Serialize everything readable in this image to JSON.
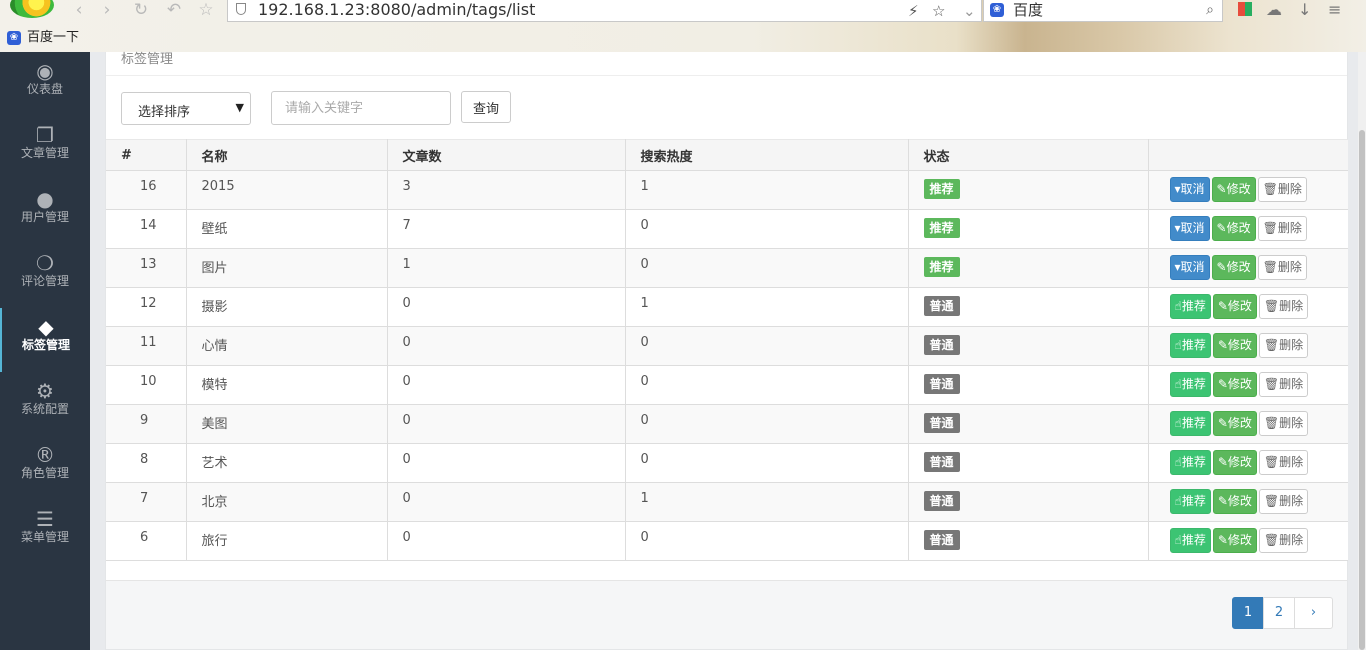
{
  "browser": {
    "url": "192.168.1.23:8080/admin/tags/list",
    "search_engine": "百度",
    "bookmark": "百度一下"
  },
  "sidebar": {
    "items": [
      {
        "label": "仪表盘",
        "icon": "dashboard-icon",
        "glyph": "◉"
      },
      {
        "label": "文章管理",
        "icon": "documents-icon",
        "glyph": "❐"
      },
      {
        "label": "用户管理",
        "icon": "user-icon",
        "glyph": "●"
      },
      {
        "label": "评论管理",
        "icon": "comments-icon",
        "glyph": "❍"
      },
      {
        "label": "标签管理",
        "icon": "tags-icon",
        "glyph": "◆",
        "active": true
      },
      {
        "label": "系统配置",
        "icon": "gear-icon",
        "glyph": "⚙"
      },
      {
        "label": "角色管理",
        "icon": "registered-icon",
        "glyph": "®"
      },
      {
        "label": "菜单管理",
        "icon": "bars-icon",
        "glyph": "☰"
      }
    ]
  },
  "panel": {
    "heading": "标签管理",
    "sort_select": "选择排序",
    "keyword_placeholder": "请输入关键字",
    "query_button": "查询"
  },
  "table": {
    "headers": [
      "#",
      "名称",
      "文章数",
      "搜索热度",
      "状态",
      ""
    ],
    "rows": [
      {
        "id": "16",
        "name": "2015",
        "articles": "3",
        "heat": "1",
        "status": "推荐",
        "recommended": true
      },
      {
        "id": "14",
        "name": "壁纸",
        "articles": "7",
        "heat": "0",
        "status": "推荐",
        "recommended": true
      },
      {
        "id": "13",
        "name": "图片",
        "articles": "1",
        "heat": "0",
        "status": "推荐",
        "recommended": true
      },
      {
        "id": "12",
        "name": "摄影",
        "articles": "0",
        "heat": "1",
        "status": "普通",
        "recommended": false
      },
      {
        "id": "11",
        "name": "心情",
        "articles": "0",
        "heat": "0",
        "status": "普通",
        "recommended": false
      },
      {
        "id": "10",
        "name": "模特",
        "articles": "0",
        "heat": "0",
        "status": "普通",
        "recommended": false
      },
      {
        "id": "9",
        "name": "美图",
        "articles": "0",
        "heat": "0",
        "status": "普通",
        "recommended": false
      },
      {
        "id": "8",
        "name": "艺术",
        "articles": "0",
        "heat": "0",
        "status": "普通",
        "recommended": false
      },
      {
        "id": "7",
        "name": "北京",
        "articles": "0",
        "heat": "1",
        "status": "普通",
        "recommended": false
      },
      {
        "id": "6",
        "name": "旅行",
        "articles": "0",
        "heat": "0",
        "status": "普通",
        "recommended": false
      }
    ],
    "actions": {
      "cancel": "取消",
      "recommend": "推荐",
      "edit": "修改",
      "delete": "删除"
    }
  },
  "pagination": {
    "pages": [
      "1",
      "2"
    ],
    "current": "1",
    "next": "›"
  },
  "colors": {
    "sidebar_bg": "#2a3542",
    "primary": "#428bca",
    "success": "#5cb85c",
    "default_badge": "#777777"
  }
}
